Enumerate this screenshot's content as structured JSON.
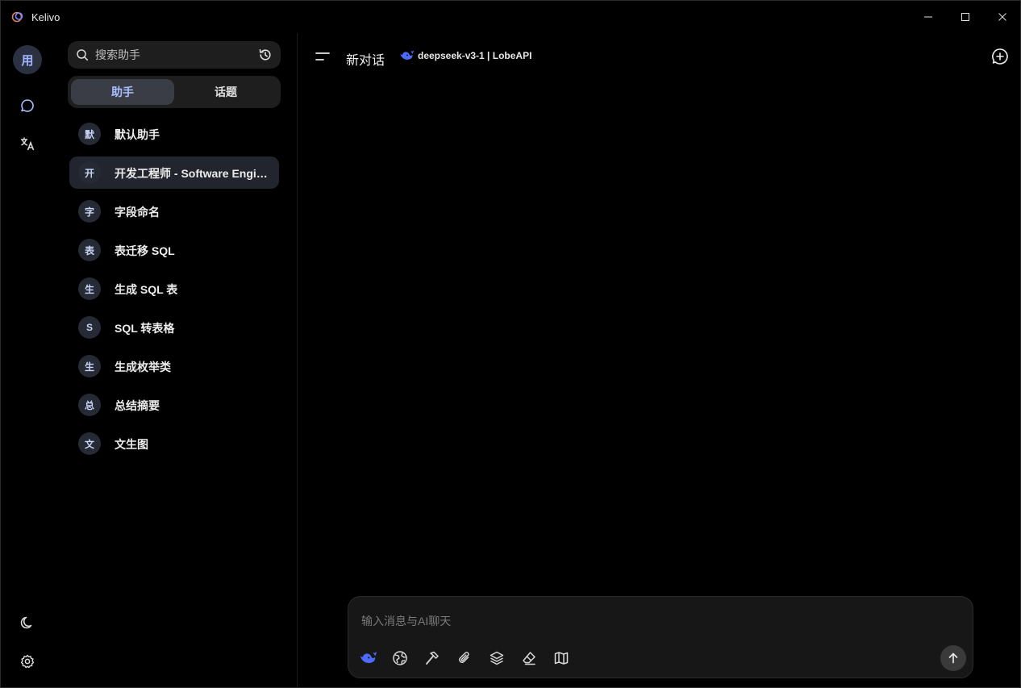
{
  "window": {
    "title": "Kelivo"
  },
  "rail": {
    "avatar_char": "用"
  },
  "sidebar": {
    "search_placeholder": "搜索助手",
    "tabs": [
      {
        "label": "助手",
        "active": true
      },
      {
        "label": "话题",
        "active": false
      }
    ],
    "assistants": [
      {
        "avatar": "默",
        "label": "默认助手",
        "selected": false
      },
      {
        "avatar": "开",
        "label": "开发工程师 - Software Engineer",
        "selected": true
      },
      {
        "avatar": "字",
        "label": "字段命名",
        "selected": false
      },
      {
        "avatar": "表",
        "label": "表迁移 SQL",
        "selected": false
      },
      {
        "avatar": "生",
        "label": "生成 SQL 表",
        "selected": false
      },
      {
        "avatar": "S",
        "label": "SQL 转表格",
        "selected": false
      },
      {
        "avatar": "生",
        "label": "生成枚举类",
        "selected": false
      },
      {
        "avatar": "总",
        "label": "总结摘要",
        "selected": false
      },
      {
        "avatar": "文",
        "label": "文生图",
        "selected": false
      }
    ]
  },
  "main": {
    "chat_title": "新对话",
    "model_label": "deepseek-v3-1 | LobeAPI",
    "composer_placeholder": "输入消息与AI聊天"
  },
  "colors": {
    "accent": "#a9c0ff",
    "model_icon": "#4d6bfe",
    "background": "#000000"
  }
}
